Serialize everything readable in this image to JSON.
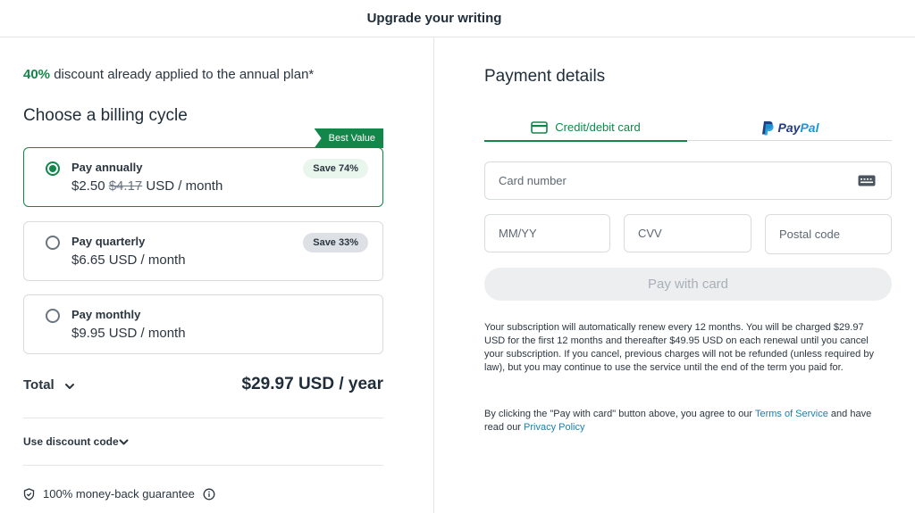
{
  "header": {
    "title": "Upgrade your writing"
  },
  "left": {
    "discount_pct": "40%",
    "discount_text": " discount already applied to the annual plan*",
    "billing_heading": "Choose a billing cycle",
    "best_value": "Best Value",
    "plans": [
      {
        "name": "Pay annually",
        "price": "$2.50",
        "old_price": "$4.17",
        "price_suffix": " USD / month",
        "save": "Save 74%",
        "selected": true
      },
      {
        "name": "Pay quarterly",
        "price": "$6.65 USD / month",
        "save": "Save 33%",
        "selected": false
      },
      {
        "name": "Pay monthly",
        "price": "$9.95 USD / month",
        "selected": false
      }
    ],
    "total_label": "Total",
    "total_value": "$29.97 USD / year",
    "discount_code_label": "Use discount code",
    "guarantee": "100% money-back guarantee"
  },
  "right": {
    "heading": "Payment details",
    "tabs": {
      "card": "Credit/debit card",
      "paypal_a": "Pay",
      "paypal_b": "Pal"
    },
    "placeholders": {
      "card_number": "Card number",
      "expiry": "MM/YY",
      "cvv": "CVV",
      "postal": "Postal code"
    },
    "pay_button": "Pay with card",
    "legal_renewal": "Your subscription will automatically renew every 12 months. You will be charged $29.97 USD for the first 12 months and thereafter $49.95 USD on each renewal until you cancel your subscription. If you cancel, previous charges will not be refunded (unless required by law), but you may continue to use the service until the end of the term you paid for.",
    "legal_terms_pre": "By clicking the \"Pay with card\" button above, you agree to our ",
    "terms_link": "Terms of Service",
    "legal_terms_mid": " and have read our ",
    "privacy_link": "Privacy Policy"
  },
  "colors": {
    "accent": "#13864a",
    "link": "#1d80b0",
    "paypal_dark": "#253b80",
    "paypal_light": "#179bd7"
  },
  "icons": [
    "credit-card-icon",
    "paypal-logo-icon",
    "card-reader-icon",
    "chevron-down-icon",
    "shield-check-icon",
    "info-icon"
  ]
}
